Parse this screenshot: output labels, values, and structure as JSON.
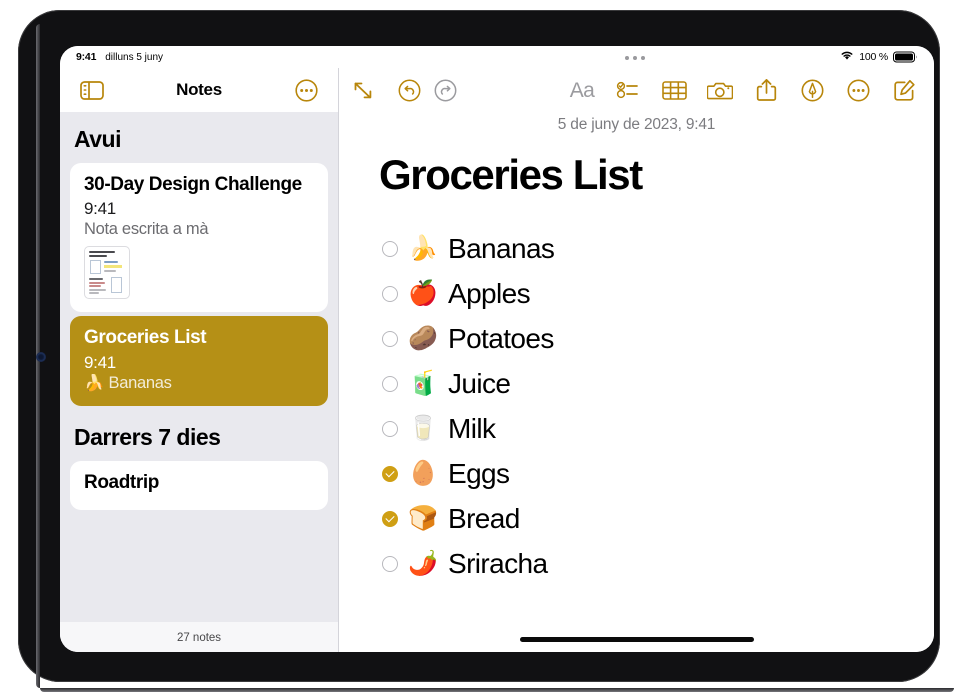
{
  "status_bar": {
    "time": "9:41",
    "date": "dilluns 5 juny",
    "battery_percent": "100 %",
    "wifi_icon": "wifi-icon",
    "battery_icon": "battery-full-icon"
  },
  "sidebar": {
    "title": "Notes",
    "toggle_icon": "sidebar-toggle-icon",
    "more_icon": "more-ellipsis-circle-icon",
    "footer_count": "27 notes",
    "sections": [
      {
        "header": "Avui",
        "notes": [
          {
            "title": "30-Day Design Challenge",
            "time": "9:41",
            "snippet": "Nota escrita a mà",
            "selected": false,
            "has_thumbnail": true
          },
          {
            "title": "Groceries List",
            "time": "9:41",
            "snippet": "🍌 Bananas",
            "selected": true,
            "has_thumbnail": false
          }
        ]
      },
      {
        "header": "Darrers 7 dies",
        "notes": [
          {
            "title": "Roadtrip",
            "time": "",
            "snippet": "",
            "selected": false,
            "has_thumbnail": false
          }
        ]
      }
    ]
  },
  "toolbar": {
    "items": [
      {
        "name": "expand-icon",
        "label": "Expandeix",
        "color": "#b8860b",
        "type": "icon"
      },
      {
        "name": "undo-icon",
        "label": "Desfés",
        "color": "#b8860b",
        "type": "icon"
      },
      {
        "name": "redo-icon",
        "label": "Refés",
        "color": "#9b9b9f",
        "type": "icon"
      },
      {
        "name": "format-text-icon",
        "label": "Aa",
        "color": "#9b9b9f",
        "type": "text"
      },
      {
        "name": "checklist-icon",
        "label": "Llista",
        "color": "#b8860b",
        "type": "icon"
      },
      {
        "name": "table-icon",
        "label": "Taula",
        "color": "#b8860b",
        "type": "icon"
      },
      {
        "name": "camera-icon",
        "label": "Càmera",
        "color": "#b8860b",
        "type": "icon"
      },
      {
        "name": "share-icon",
        "label": "Comparteix",
        "color": "#b8860b",
        "type": "icon"
      },
      {
        "name": "markup-pen-icon",
        "label": "Marca",
        "color": "#b8860b",
        "type": "icon"
      },
      {
        "name": "more-icon",
        "label": "Més",
        "color": "#b8860b",
        "type": "icon"
      },
      {
        "name": "compose-icon",
        "label": "Nota nova",
        "color": "#b8860b",
        "type": "icon"
      }
    ],
    "format_label": "Aa"
  },
  "note": {
    "date": "5 de juny de 2023, 9:41",
    "title": "Groceries List",
    "checklist": [
      {
        "emoji": "🍌",
        "text": "Bananas",
        "checked": false
      },
      {
        "emoji": "🍎",
        "text": "Apples",
        "checked": false
      },
      {
        "emoji": "🥔",
        "text": "Potatoes",
        "checked": false
      },
      {
        "emoji": "🧃",
        "text": "Juice",
        "checked": false
      },
      {
        "emoji": "🥛",
        "text": "Milk",
        "checked": false
      },
      {
        "emoji": "🥚",
        "text": "Eggs",
        "checked": true
      },
      {
        "emoji": "🍞",
        "text": "Bread",
        "checked": true
      },
      {
        "emoji": "🌶️",
        "text": "Sriracha",
        "checked": false
      }
    ]
  },
  "colors": {
    "accent_gold": "#b8860b",
    "selected_note_bg": "#b59016",
    "checked_circle": "#cf9f14",
    "sidebar_bg": "#e9e9ee"
  }
}
